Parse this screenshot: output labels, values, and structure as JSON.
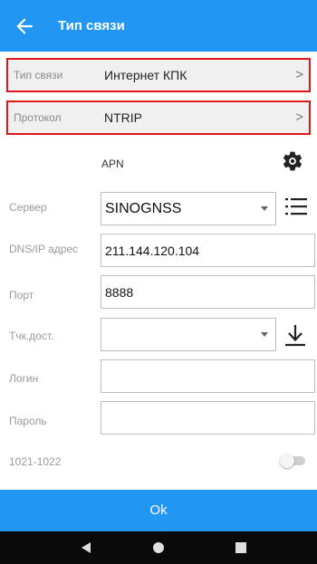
{
  "header": {
    "title": "Тип связи",
    "back_icon": "arrow-back-icon"
  },
  "connection_type": {
    "label": "Тип связи",
    "value": "Интернет КПК",
    "chevron": ">"
  },
  "protocol": {
    "label": "Протокол",
    "value": "NTRIP",
    "chevron": ">"
  },
  "apn": {
    "label": "APN",
    "settings_icon": "gear-icon"
  },
  "server": {
    "label": "Сервер",
    "value": "SINOGNSS",
    "list_icon": "list-icon"
  },
  "dns": {
    "label": "DNS/IP адрес",
    "value": "211.144.120.104"
  },
  "port": {
    "label": "Порт",
    "value": "8888"
  },
  "mountpoint": {
    "label": "Тчк.дост.",
    "value": "",
    "download_icon": "download-icon"
  },
  "login": {
    "label": "Логин",
    "value": ""
  },
  "password": {
    "label": "Пароль",
    "value": ""
  },
  "rtcm": {
    "label": "1021-1022",
    "enabled": false
  },
  "ok_button": {
    "label": "Ok"
  },
  "colors": {
    "primary": "#2196f3",
    "highlight_border": "#e0161b",
    "nav_bar": "#0a0a0a"
  }
}
